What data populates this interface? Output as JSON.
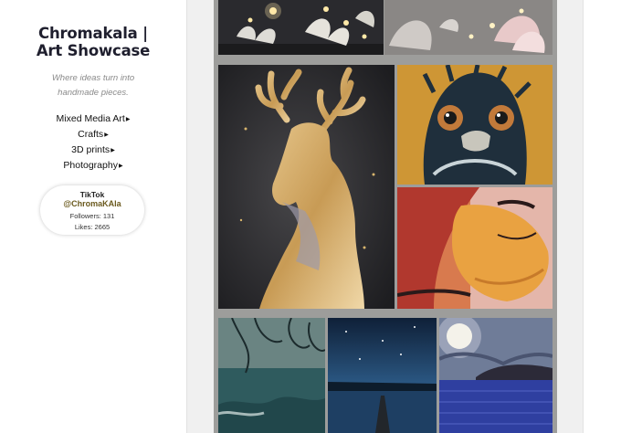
{
  "sidebar": {
    "title_line1": "Chromakala |",
    "title_line2": "Art Showcase",
    "tagline_line1": "Where ideas turn into",
    "tagline_line2": "handmade pieces.",
    "nav": [
      {
        "label": "Mixed Media Art"
      },
      {
        "label": "Crafts"
      },
      {
        "label": "3D prints"
      },
      {
        "label": "Photography"
      }
    ],
    "nav_caret": "▶",
    "social": {
      "network": "TikTok",
      "handle": "@ChromaKAla",
      "followers": "Followers: 131",
      "likes": "Likes: 2665"
    }
  },
  "colors": {
    "title": "#1f1f2e",
    "handle": "#6b5a1e",
    "gallery_bg": "#9d9d9b"
  },
  "gallery": {
    "items": [
      {
        "icon": "butterfly-lights-artwork"
      },
      {
        "icon": "butterfly-lights-artwork-2"
      },
      {
        "icon": "gold-deer-artwork"
      },
      {
        "icon": "emu-painting"
      },
      {
        "icon": "abstract-face-painting"
      },
      {
        "icon": "stormy-sea-painting"
      },
      {
        "icon": "night-pier-painting"
      },
      {
        "icon": "moonlit-lake-painting"
      }
    ]
  }
}
